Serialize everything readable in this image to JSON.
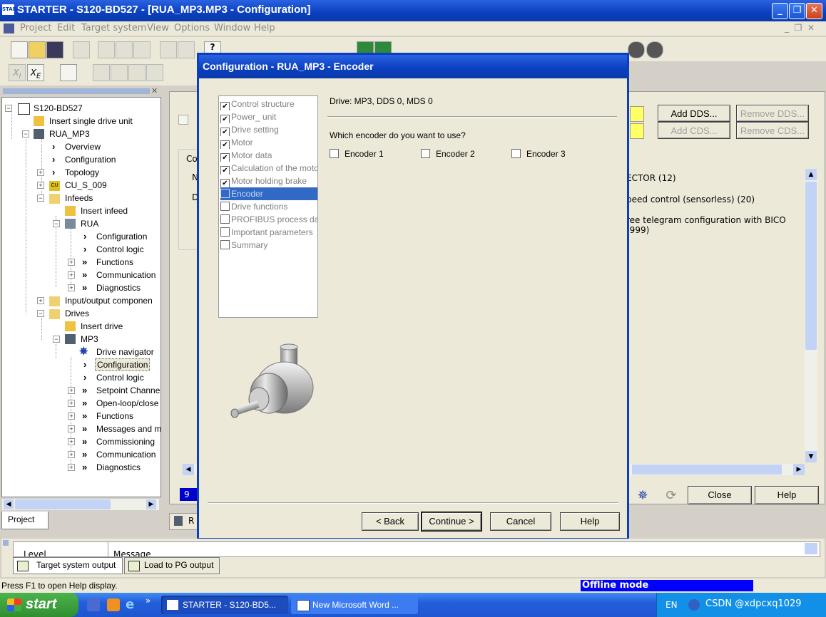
{
  "app": {
    "title": "STARTER - S120-BD527 - [RUA_MP3.MP3 - Configuration]",
    "icon_text": "STAR"
  },
  "menubar": [
    "Project",
    "Edit",
    "Target system",
    "View",
    "Options",
    "Window",
    "Help"
  ],
  "tree": {
    "root": "S120-BD527",
    "items": [
      "Insert single drive unit",
      "RUA_MP3",
      "Overview",
      "Configuration",
      "Topology",
      "CU_S_009",
      "Infeeds",
      "Insert infeed",
      "RUA",
      "Configuration",
      "Control logic",
      "Functions",
      "Communication",
      "Diagnostics",
      "Input/output componen",
      "Drives",
      "Insert drive",
      "MP3",
      "Drive navigator",
      "Configuration",
      "Control logic",
      "Setpoint Channe",
      "Open-loop/close",
      "Functions",
      "Messages and m",
      "Commissioning",
      "Communication",
      "Diagnostics"
    ],
    "tab": "Project"
  },
  "background": {
    "add_dds": "Add DDS...",
    "remove_dds": "Remove DDS...",
    "add_cds": "Add CDS...",
    "remove_cds": "Remove CDS...",
    "line1": "ECTOR (12)",
    "line2": "peed control (sensorless) (20)",
    "line3": "ree telegram configuration with BICO (999)",
    "close": "Close",
    "help": "Help",
    "small_field": "9",
    "tab_left": "Co",
    "n_label": "N",
    "d_label": "D",
    "bottom_tab": "R"
  },
  "dialog": {
    "title": "Configuration - RUA_MP3 - Encoder",
    "drive_info": "Drive: MP3, DDS 0, MDS 0",
    "question": "Which encoder do you want to use?",
    "encoders": [
      "Encoder 1",
      "Encoder 2",
      "Encoder 3"
    ],
    "steps": [
      {
        "label": "Control structure",
        "checked": true
      },
      {
        "label": "Power_ unit",
        "checked": true
      },
      {
        "label": "Drive setting",
        "checked": true
      },
      {
        "label": "Motor",
        "checked": true
      },
      {
        "label": "Motor data",
        "checked": true
      },
      {
        "label": "Calculation of the moto",
        "checked": true
      },
      {
        "label": "Motor holding brake",
        "checked": true
      },
      {
        "label": "Encoder",
        "checked": false
      },
      {
        "label": "Drive functions",
        "checked": false
      },
      {
        "label": "PROFIBUS process da",
        "checked": false
      },
      {
        "label": "Important parameters",
        "checked": false
      },
      {
        "label": "Summary",
        "checked": false
      }
    ],
    "buttons": {
      "back": "< Back",
      "continue": "Continue >",
      "cancel": "Cancel",
      "help": "Help"
    }
  },
  "output": {
    "col_level": "Level",
    "col_message": "Message",
    "tab1": "Target system output",
    "tab2": "Load to PG output"
  },
  "status": {
    "help_text": "Press F1 to open Help display.",
    "mode": "Offline mode"
  },
  "taskbar": {
    "start": "start",
    "task1": "STARTER - S120-BD5...",
    "task2": "New Microsoft Word ...",
    "lang": "EN",
    "tray_text": "CSDN @xdpcxq1029"
  },
  "colors": {
    "title_blue": "#0a3fc0",
    "selection": "#316ac5",
    "offline_blue": "#0000ff"
  }
}
